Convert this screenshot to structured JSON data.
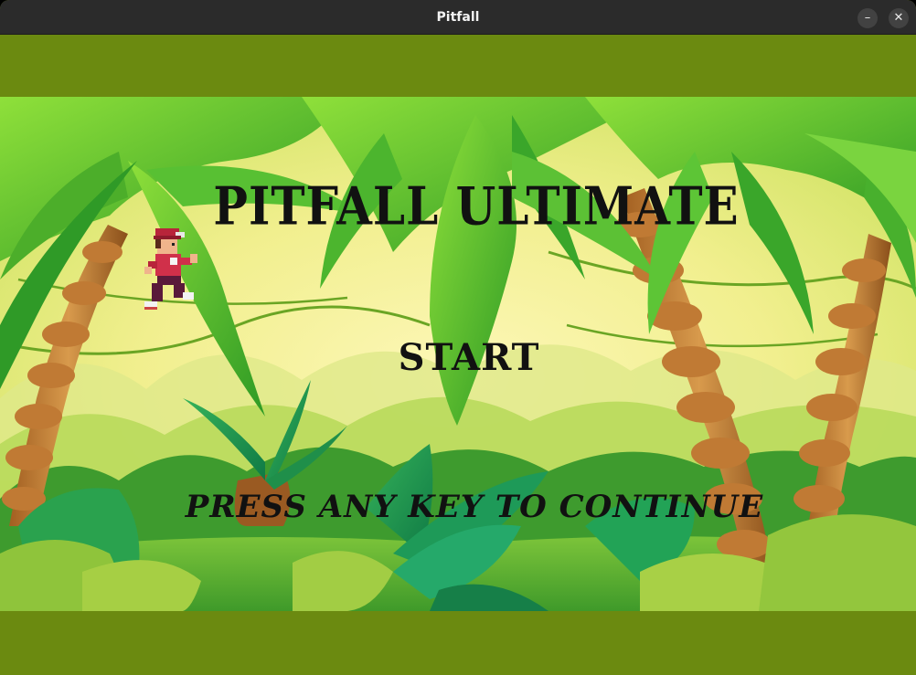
{
  "window": {
    "title": "Pitfall",
    "minimize_glyph": "–",
    "close_glyph": "✕"
  },
  "game": {
    "title": "PITFALL ULTIMATE",
    "start_label": "START",
    "continue_hint": "PRESS ANY KEY TO CONTINUE"
  },
  "colors": {
    "band": "#6b8a10",
    "titlebar": "#2b2b2b",
    "text": "#111111"
  },
  "icons": {
    "minimize": "minimize-icon",
    "close": "close-icon",
    "player": "player-sprite"
  }
}
